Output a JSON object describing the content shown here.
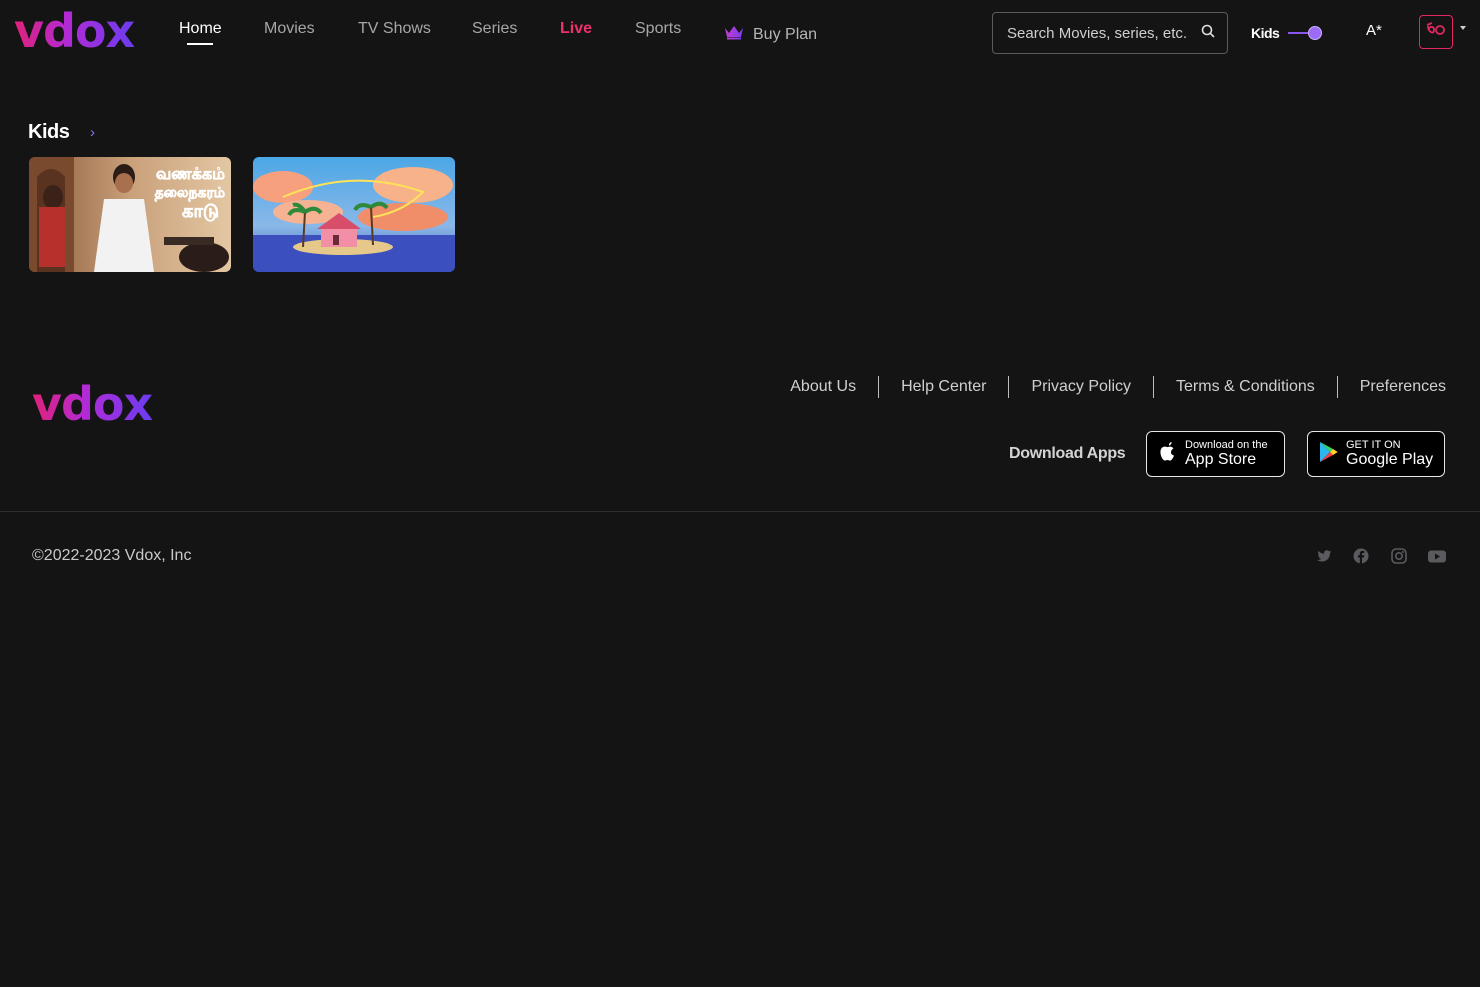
{
  "brand": {
    "name": "vdox",
    "gradient": [
      "#e0217a",
      "#b12bd6",
      "#6b3cf0"
    ]
  },
  "nav": {
    "items": [
      {
        "label": "Home",
        "active": true
      },
      {
        "label": "Movies"
      },
      {
        "label": "TV Shows"
      },
      {
        "label": "Series"
      },
      {
        "label": "Live",
        "highlight": "#f0306c"
      },
      {
        "label": "Sports"
      }
    ],
    "buy_plan": {
      "label": "Buy Plan",
      "icon": "crown-icon"
    }
  },
  "header": {
    "search": {
      "placeholder": "Search Movies, series, etc.",
      "icon": "search-icon"
    },
    "kids": {
      "label": "Kids",
      "enabled": true
    },
    "language_icon": "A*",
    "avatar_icon": "vdox-avatar-icon"
  },
  "main": {
    "section": {
      "title": "Kids",
      "cards": [
        {
          "poster_text": [
            "வணக்கம்",
            "தலைநகரம்",
            "காடு"
          ]
        },
        {
          "icon": "island-house-thumbnail"
        }
      ]
    }
  },
  "footer": {
    "links": [
      "About Us",
      "Help Center",
      "Privacy Policy",
      "Terms & Conditions",
      "Preferences"
    ],
    "download_label": "Download Apps",
    "app_store": {
      "small": "Download on the",
      "big": "App Store"
    },
    "google_play": {
      "small": "GET IT ON",
      "big": "Google Play"
    },
    "copyright": "©2022-2023 Vdox, Inc",
    "social": [
      "twitter-icon",
      "facebook-icon",
      "instagram-icon",
      "youtube-icon"
    ]
  },
  "colors": {
    "background": "#141415",
    "accent": "#8b55f0",
    "live": "#f0306c"
  }
}
